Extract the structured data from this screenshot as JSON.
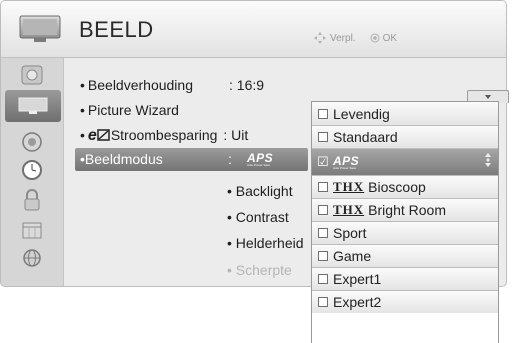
{
  "header": {
    "title": "BEELD",
    "hint_nav_label": "Verpl.",
    "hint_ok_label": "OK"
  },
  "menu_items": [
    {
      "label": "Beeldverhouding",
      "separator": ":",
      "value": "16:9"
    },
    {
      "label": "Picture Wizard"
    },
    {
      "logo_text": "e",
      "label": "Stroombesparing",
      "separator": ":",
      "value": "Uit"
    },
    {
      "label": "Beeldmodus",
      "separator": ":",
      "value_logo": "APS",
      "value_logo_sub": "Auto Power Save"
    }
  ],
  "sub_items": [
    "Backlight",
    "Contrast",
    "Helderheid",
    "Scherpte"
  ],
  "dropdown": {
    "options": [
      {
        "label": "Levendig"
      },
      {
        "label": "Standaard"
      },
      {
        "logo": "APS",
        "logo_sub": "Auto Power Save",
        "selected": true
      },
      {
        "prefix": "THX",
        "label": "Bioscoop"
      },
      {
        "prefix": "THX",
        "label": "Bright Room"
      },
      {
        "label": "Sport"
      },
      {
        "label": "Game"
      },
      {
        "label": "Expert1"
      },
      {
        "label": "Expert2"
      }
    ]
  },
  "icons": {
    "header": "tv-icon",
    "sidebar": [
      "picture-icon",
      "tv-screen-icon",
      "speaker-icon",
      "clock-icon",
      "lock-icon",
      "calendar-icon",
      "globe-icon"
    ]
  },
  "colors": {
    "selection": "#888888",
    "background": "#ececec",
    "dropdown_bg": "#f4f4f4"
  }
}
